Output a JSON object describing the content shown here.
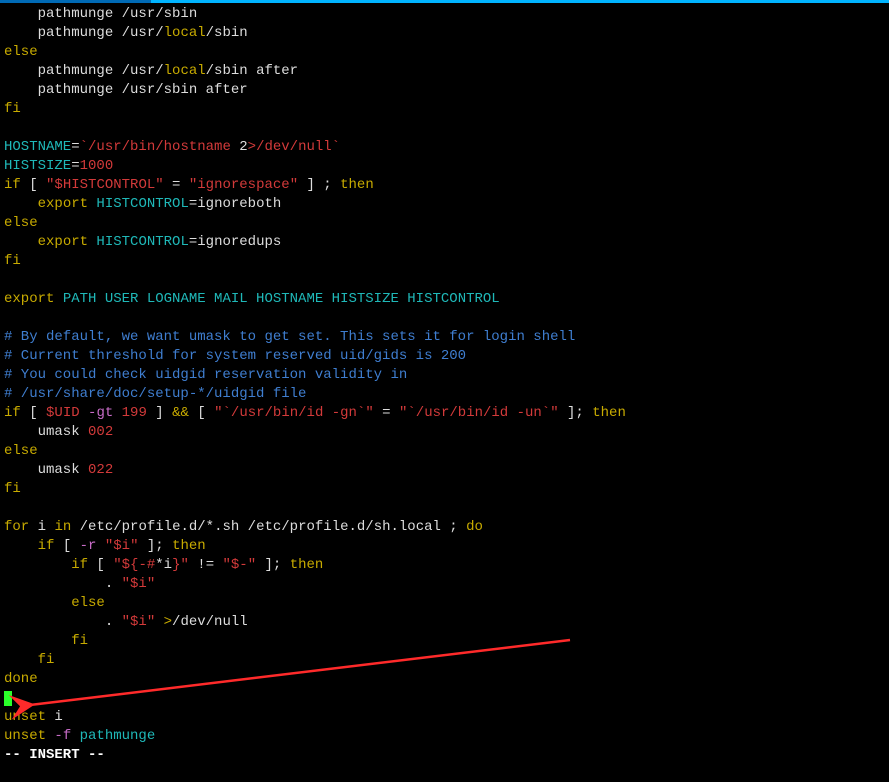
{
  "lines": {
    "l1_a": "    pathmunge /usr/sbin",
    "l2_a": "    pathmunge /usr/",
    "l2_b": "local",
    "l2_c": "/sbin",
    "l3": "else",
    "l4_a": "    pathmunge /usr/",
    "l4_b": "local",
    "l4_c": "/sbin after",
    "l5": "    pathmunge /usr/sbin after",
    "l6": "fi",
    "l8_a": "HOSTNAME",
    "l8_b": "=",
    "l8_c": "`/usr/bin/hostname ",
    "l8_d": "2",
    "l8_e": ">/dev/null`",
    "l9_a": "HISTSIZE",
    "l9_b": "=",
    "l9_c": "1000",
    "l10_a": "if",
    "l10_b": " [ ",
    "l10_c": "\"$HISTCONTROL\"",
    "l10_d": " = ",
    "l10_e": "\"ignorespace\"",
    "l10_f": " ] ; ",
    "l10_g": "then",
    "l11_a": "    ",
    "l11_b": "export",
    "l11_c": " HISTCONTROL",
    "l11_d": "=ignoreboth",
    "l12": "else",
    "l13_a": "    ",
    "l13_b": "export",
    "l13_c": " HISTCONTROL",
    "l13_d": "=ignoredups",
    "l14": "fi",
    "l16_a": "export",
    "l16_b": " PATH USER LOGNAME MAIL HOSTNAME HISTSIZE HISTCONTROL",
    "l18": "# By default, we want umask to get set. This sets it for login shell",
    "l19": "# Current threshold for system reserved uid/gids is 200",
    "l20": "# You could check uidgid reservation validity in",
    "l21": "# /usr/share/doc/setup-*/uidgid file",
    "l22_a": "if",
    "l22_b": " [ ",
    "l22_c": "$UID",
    "l22_d": " -gt ",
    "l22_e": "199",
    "l22_f": " ] ",
    "l22_g": "&&",
    "l22_h": " [ ",
    "l22_i": "\"`/usr/bin/id -gn`\"",
    "l22_j": " = ",
    "l22_k": "\"`/usr/bin/id -un`\"",
    "l22_l": " ]; ",
    "l22_m": "then",
    "l23_a": "    umask ",
    "l23_b": "002",
    "l24": "else",
    "l25_a": "    umask ",
    "l25_b": "022",
    "l26": "fi",
    "l28_a": "for",
    "l28_b": " i ",
    "l28_c": "in",
    "l28_d": " /etc/profile.d/*.sh /etc/profile.d/sh.local ; ",
    "l28_e": "do",
    "l29_a": "    ",
    "l29_b": "if",
    "l29_c": " [ ",
    "l29_d": "-r",
    "l29_e": " ",
    "l29_f": "\"$i\"",
    "l29_g": " ]; ",
    "l29_h": "then",
    "l30_a": "        ",
    "l30_b": "if",
    "l30_c": " [ ",
    "l30_d": "\"${-#",
    "l30_e": "*i",
    "l30_f": "}\"",
    "l30_g": " != ",
    "l30_h": "\"$-\"",
    "l30_i": " ]; ",
    "l30_j": "then",
    "l31_a": "            . ",
    "l31_b": "\"$i\"",
    "l32": "        else",
    "l33_a": "            . ",
    "l33_b": "\"$i\"",
    "l33_c": " >",
    "l33_d": "/dev/null",
    "l34": "        fi",
    "l35": "    fi",
    "l36": "done",
    "l38_a": "unset",
    "l38_b": " i",
    "l39_a": "unset",
    "l39_b": " -f ",
    "l39_c": "pathmunge"
  },
  "status": "-- INSERT --"
}
